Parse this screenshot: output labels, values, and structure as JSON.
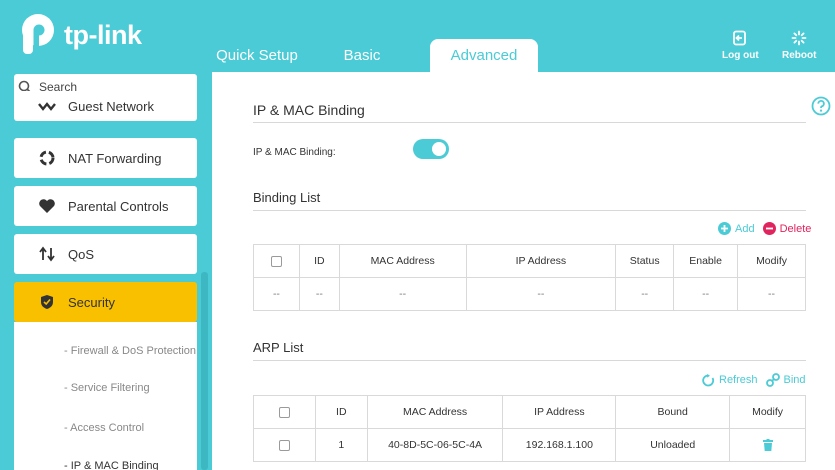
{
  "brand": {
    "name": "tp-link"
  },
  "tabs": [
    {
      "label": "Quick Setup"
    },
    {
      "label": "Basic"
    },
    {
      "label": "Advanced"
    }
  ],
  "header_buttons": {
    "logout": "Log out",
    "reboot": "Reboot"
  },
  "sidebar": {
    "search_label": "Search",
    "items": [
      {
        "label": "Guest Network",
        "icon": "guest-network-icon"
      },
      {
        "label": "NAT Forwarding",
        "icon": "nat-forwarding-icon"
      },
      {
        "label": "Parental Controls",
        "icon": "heart-icon"
      },
      {
        "label": "QoS",
        "icon": "updown-arrows-icon"
      },
      {
        "label": "Security",
        "icon": "shield-icon",
        "active": true
      }
    ],
    "sub_items": [
      {
        "label": "- Firewall & DoS Protection"
      },
      {
        "label": "- Service Filtering"
      },
      {
        "label": "- Access Control"
      },
      {
        "label": "- IP & MAC Binding",
        "active": true
      }
    ]
  },
  "main": {
    "section1_title": "IP & MAC Binding",
    "binding_toggle_label": "IP & MAC Binding:",
    "binding_toggle_on": true,
    "binding_list": {
      "title": "Binding List",
      "add_label": "Add",
      "delete_label": "Delete",
      "headers": [
        "ID",
        "MAC Address",
        "IP Address",
        "Status",
        "Enable",
        "Modify"
      ],
      "row": [
        "--",
        "--",
        "--",
        "--",
        "--",
        "--",
        "--"
      ]
    },
    "arp_list": {
      "title": "ARP List",
      "refresh_label": "Refresh",
      "bind_label": "Bind",
      "headers": [
        "ID",
        "MAC Address",
        "IP Address",
        "Bound",
        "Modify"
      ],
      "row": {
        "id": "1",
        "mac": "40-8D-5C-06-5C-4A",
        "ip": "192.168.1.100",
        "bound": "Unloaded"
      }
    }
  },
  "colors": {
    "brand_teal": "#4acbd6",
    "active_yellow": "#f9c000",
    "delete_red": "#e0245e"
  }
}
